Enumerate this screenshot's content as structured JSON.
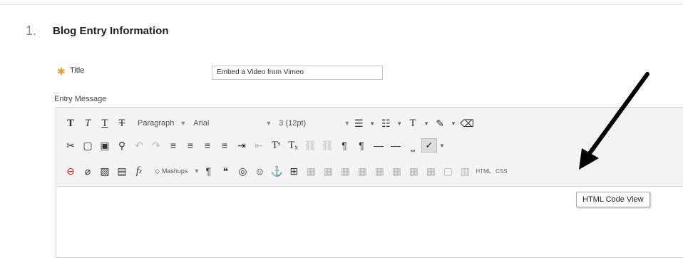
{
  "section": {
    "number": "1.",
    "title": "Blog Entry Information"
  },
  "form": {
    "required_marker": "✱",
    "title_label": "Title",
    "title_value": "Embed a Video from Vimeo",
    "entry_label": "Entry Message"
  },
  "toolbar": {
    "paragraph": "Paragraph",
    "font": "Arial",
    "size": "3 (12pt)",
    "mashups": "Mashups",
    "html_label": "HTML",
    "css_label": "CSS"
  },
  "tooltip": "HTML Code View",
  "colors": {
    "required": "#f0a030",
    "tooltip_border": "#aaaaaa"
  }
}
